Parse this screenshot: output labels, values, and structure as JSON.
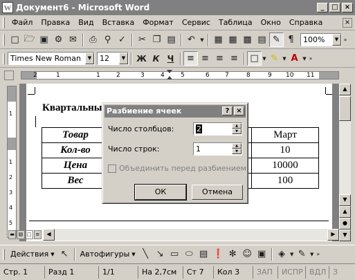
{
  "window": {
    "app_icon": "W",
    "title": "Документ6 - Microsoft Word",
    "buttons": [
      "_",
      "□",
      "×"
    ]
  },
  "menu": {
    "items": [
      "Файл",
      "Правка",
      "Вид",
      "Вставка",
      "Формат",
      "Сервис",
      "Таблица",
      "Окно",
      "Справка"
    ],
    "close": "×"
  },
  "toolbar_standard": {
    "zoom": "100%"
  },
  "toolbar_format": {
    "font": "Times New Roman",
    "size": "12",
    "bold": "Ж",
    "italic": "К",
    "underline": "Ч",
    "font_color_letter": "A"
  },
  "ruler": {
    "numbers": [
      "1",
      "2",
      "1",
      "2",
      "3",
      "4",
      "5",
      "6",
      "7",
      "8",
      "9",
      "10",
      "11"
    ]
  },
  "vruler": {
    "numbers": [
      "1",
      "1",
      "2",
      "3",
      "4",
      "5"
    ]
  },
  "document": {
    "heading": "Квартальный",
    "table": {
      "rows": [
        {
          "label": "Товар",
          "value": "Март"
        },
        {
          "label": "Кол-во",
          "value": "10"
        },
        {
          "label": "Цена",
          "value": "10000"
        },
        {
          "label": "Вес",
          "value": "100"
        }
      ]
    }
  },
  "dialog": {
    "title": "Разбиение ячеек",
    "help_btn": "?",
    "close_btn": "×",
    "columns_label": "Число столбцов:",
    "columns_value": "2",
    "rows_label": "Число строк:",
    "rows_value": "1",
    "merge_label": "Объединить перед разбиением",
    "merge_checked": false,
    "ok_label": "ОК",
    "cancel_label": "Отмена"
  },
  "drawbar": {
    "actions_label": "Действия",
    "autoshapes_label": "Автофигуры"
  },
  "status": {
    "page": "Стр. 1",
    "section": "Разд 1",
    "pages": "1/1",
    "at": "На 2,7см",
    "line": "Ст 7",
    "col": "Кол 3",
    "rec": "ЗАП",
    "trk": "ИСПР",
    "ext": "ВДЛ",
    "ovr": "З"
  }
}
